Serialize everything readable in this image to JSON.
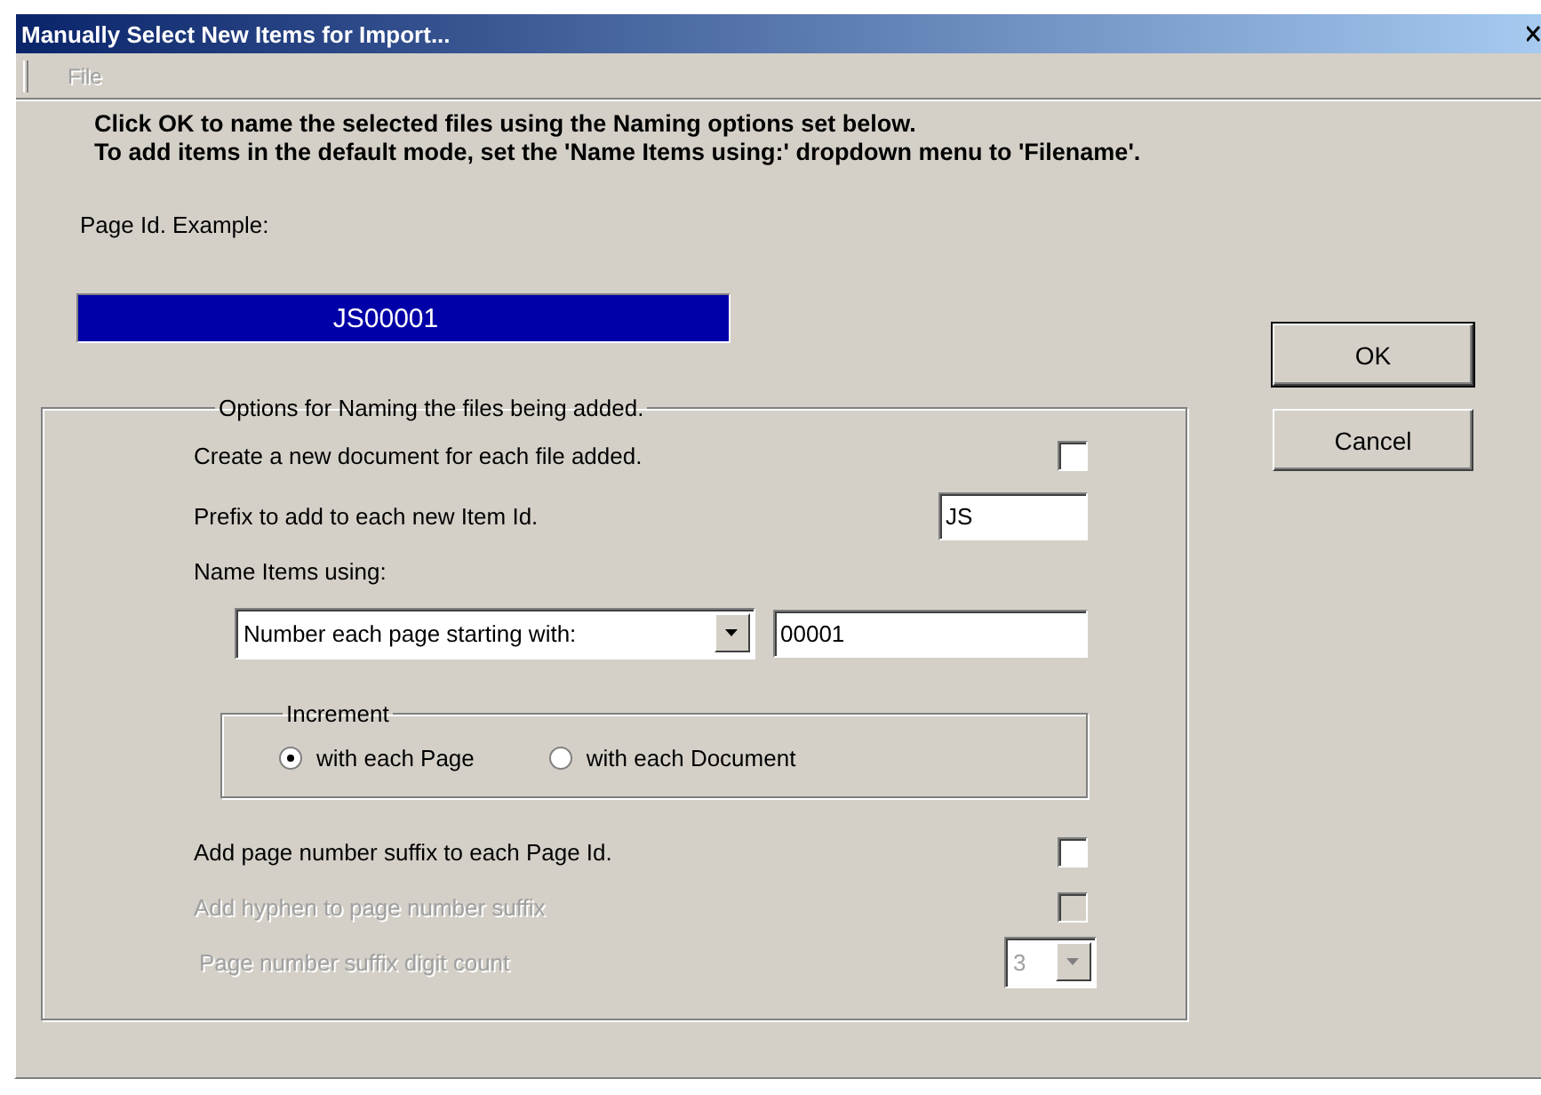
{
  "window": {
    "title": "Manually Select New Items for Import..."
  },
  "menu": [
    {
      "label": "File",
      "disabled": true
    }
  ],
  "instructions": [
    "Click OK to name the selected files using the Naming options set below.",
    "To add items in the default mode, set the 'Name Items using:' dropdown menu to 'Filename'."
  ],
  "page_id": {
    "label": "Page Id. Example:",
    "value": "JS00001"
  },
  "buttons": [
    {
      "label": "OK",
      "default": true
    },
    {
      "label": "Cancel",
      "default": false
    }
  ],
  "naming_group": {
    "title": "Options for Naming the files being added.",
    "rows": [
      {
        "kind": "checkbox",
        "label": "Create a new document for each file added.",
        "checked": false,
        "disabled": false
      },
      {
        "kind": "text",
        "label": "Prefix to add to each new Item Id.",
        "value": "JS"
      },
      {
        "kind": "heading",
        "label": "Name Items using:"
      },
      {
        "kind": "combo_text",
        "value": "Number each page starting with:",
        "text": "00001"
      },
      {
        "kind": "radio_group",
        "title": "Increment",
        "options": [
          {
            "label": "with each Page",
            "selected": true
          },
          {
            "label": "with each Document",
            "selected": false
          }
        ]
      },
      {
        "kind": "checkbox",
        "label": "Add page number suffix to each Page Id.",
        "checked": false,
        "disabled": false
      },
      {
        "kind": "checkbox",
        "label": "Add hyphen to page number suffix",
        "checked": false,
        "disabled": true
      },
      {
        "kind": "combo",
        "label": "Page number suffix digit count",
        "value": "3",
        "disabled": true
      }
    ]
  }
}
